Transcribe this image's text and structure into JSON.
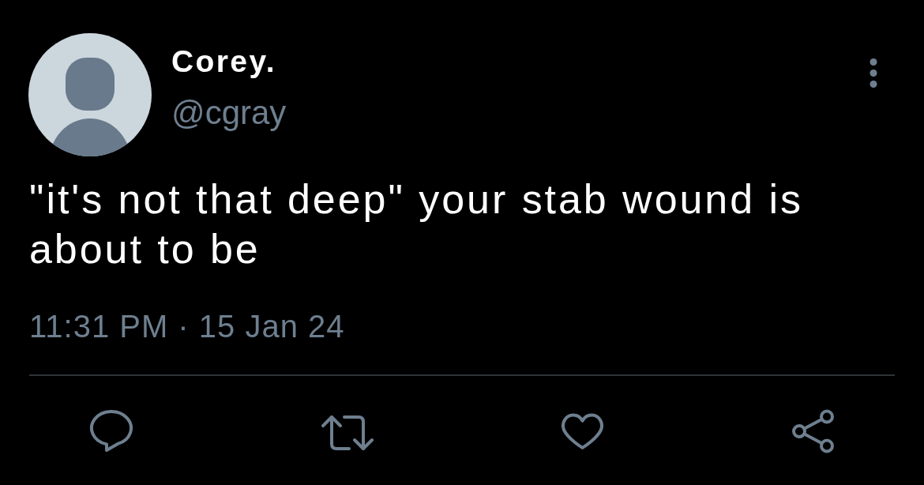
{
  "tweet": {
    "author": {
      "name": "Corey.",
      "handle": "@cgray"
    },
    "text": "\"it's not that deep\" your stab wound is about to be",
    "timestamp": "11:31 PM · 15 Jan 24"
  },
  "actions": [
    {
      "kind": "reply"
    },
    {
      "kind": "retweet"
    },
    {
      "kind": "like"
    },
    {
      "kind": "share"
    }
  ]
}
